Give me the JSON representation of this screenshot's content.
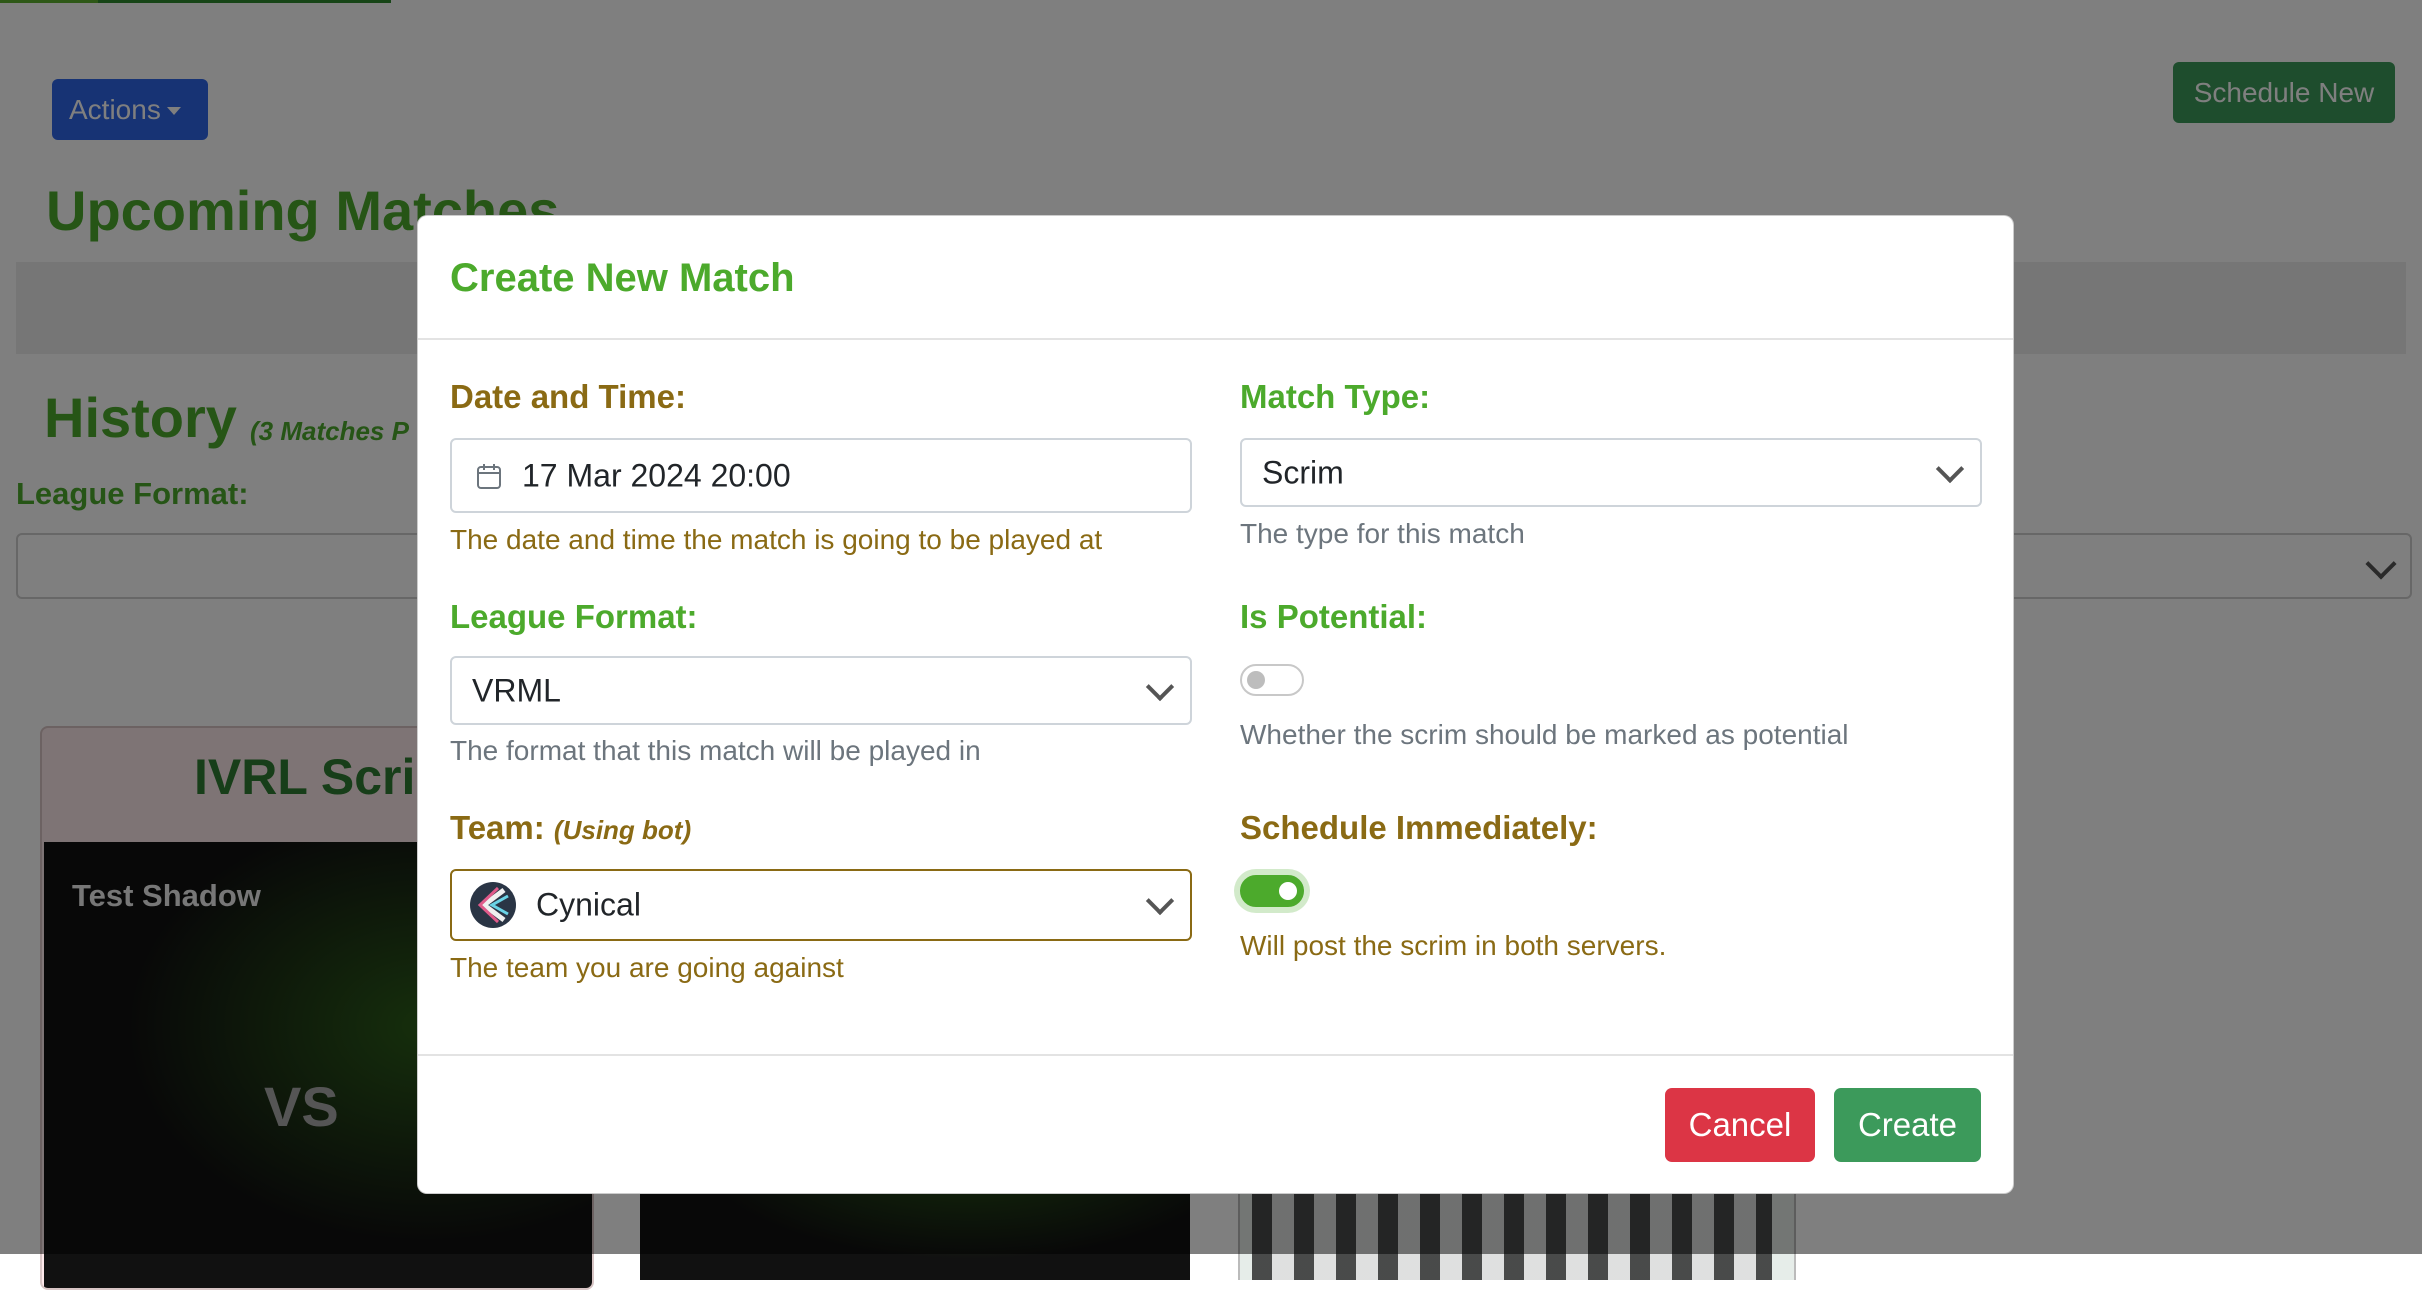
{
  "background": {
    "actions_label": "Actions",
    "schedule_new_label": "Schedule New",
    "upcoming_title": "Upcoming Matches",
    "history_title": "History",
    "history_note": "(3 Matches P",
    "league_format_label": "League Format:",
    "card_title": "IVRL Scrim",
    "card_team": "Test Shadow",
    "card_vs": "VS"
  },
  "modal": {
    "title": "Create New Match",
    "date_time": {
      "label": "Date and Time:",
      "value": "17 Mar 2024 20:00",
      "help": "The date and time the match is going to be played at"
    },
    "match_type": {
      "label": "Match Type:",
      "value": "Scrim",
      "help": "The type for this match"
    },
    "league_format": {
      "label": "League Format:",
      "value": "VRML",
      "help": "The format that this match will be played in"
    },
    "is_potential": {
      "label": "Is Potential:",
      "checked": false,
      "help": "Whether the scrim should be marked as potential"
    },
    "team": {
      "label": "Team:",
      "note": "(Using bot)",
      "value": "Cynical",
      "help": "The team you are going against"
    },
    "schedule_immediately": {
      "label": "Schedule Immediately:",
      "checked": true,
      "help": "Will post the scrim in both servers."
    },
    "cancel_label": "Cancel",
    "create_label": "Create"
  },
  "colors": {
    "accent_green": "#4caa2c",
    "label_gold": "#8a6a14",
    "cancel_red": "#dc3545",
    "create_green": "#3c9a5b",
    "actions_blue": "#2f66e8"
  },
  "icons": [
    "calendar-icon",
    "chevron-down-icon",
    "team-logo"
  ]
}
